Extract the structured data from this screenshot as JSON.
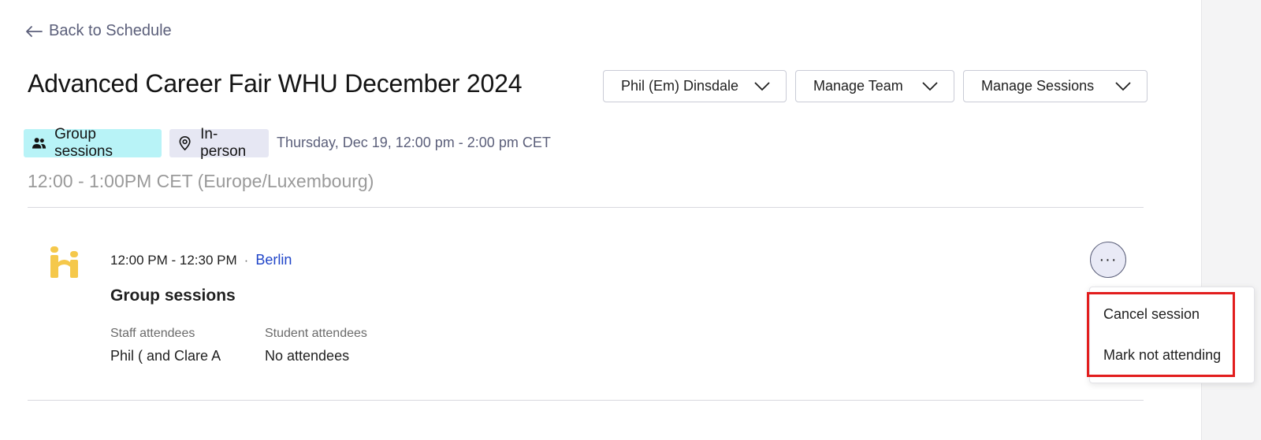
{
  "nav": {
    "back_label": "Back to Schedule"
  },
  "event": {
    "title": "Advanced Career Fair WHU December 2024",
    "date_text": "Thursday, Dec 19, 12:00 pm - 2:00 pm CET",
    "tags": [
      {
        "label": "Group sessions",
        "icon": "people-icon",
        "color": "#b8f3f7"
      },
      {
        "label": "In-person",
        "icon": "location-pin-icon",
        "color": "#e6e7f3"
      }
    ]
  },
  "header_actions": {
    "user_dropdown": "Phil (Em) Dinsdale",
    "team_dropdown": "Manage Team",
    "sessions_dropdown": "Manage Sessions"
  },
  "time_slot": {
    "heading": "12:00 - 1:00PM CET (Europe/Luxembourg)"
  },
  "session": {
    "time": "12:00 PM - 12:30 PM",
    "separator": "·",
    "location": "Berlin",
    "title": "Group sessions",
    "staff_label": "Staff attendees",
    "staff_value": "Phil ( and Clare A",
    "student_label": "Student attendees",
    "student_value": "No attendees",
    "more_label": "···"
  },
  "context_menu": {
    "items": [
      {
        "label": "Cancel session"
      },
      {
        "label": "Mark not attending"
      }
    ],
    "highlight_color": "#e21d1d"
  },
  "colors": {
    "accent_link": "#1f44c8",
    "muted_text": "#5b5f7a",
    "logo_yellow": "#f5c84b"
  }
}
